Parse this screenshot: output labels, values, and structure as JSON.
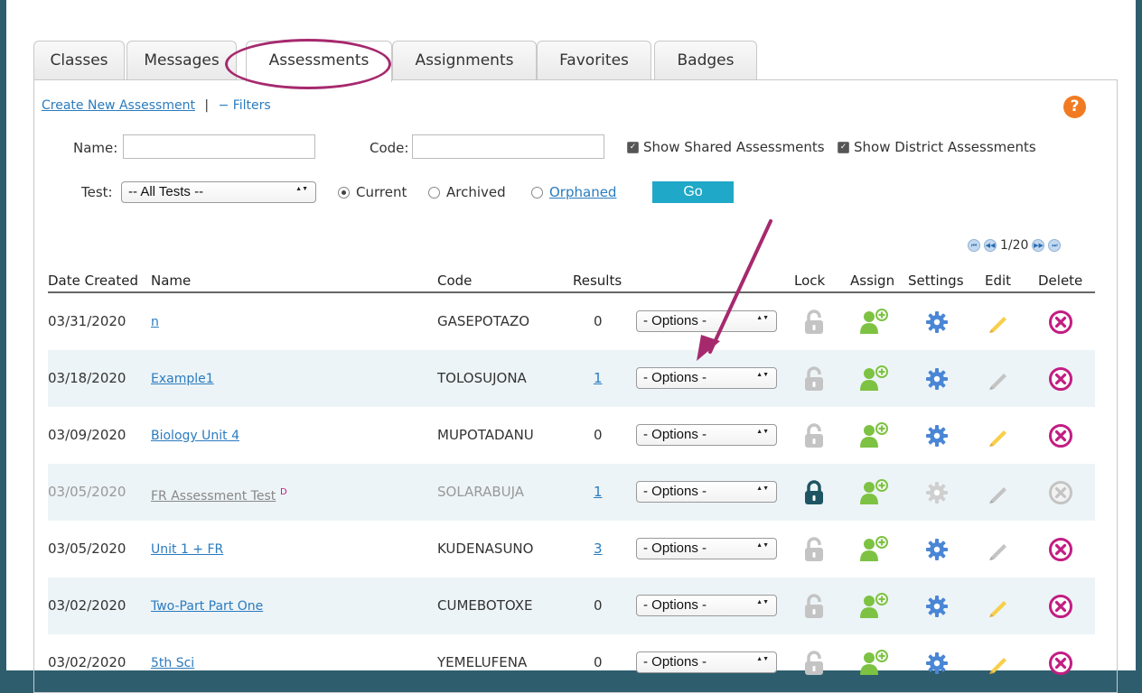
{
  "tabs": [
    "Classes",
    "Messages",
    "Assessments",
    "Assignments",
    "Favorites",
    "Badges"
  ],
  "active_tab": "Assessments",
  "links": {
    "create": "Create New Assessment",
    "separator": "|",
    "filters": "− Filters"
  },
  "help": "?",
  "filters": {
    "name_label": "Name:",
    "name_value": "",
    "code_label": "Code:",
    "code_value": "",
    "show_shared": "Show Shared Assessments",
    "show_district": "Show District Assessments",
    "test_label": "Test:",
    "test_value": "-- All Tests --",
    "radio_current": "Current",
    "radio_archived": "Archived",
    "radio_orphaned": "Orphaned",
    "selected_radio": "Current",
    "go": "Go"
  },
  "pager": {
    "text": "1/20"
  },
  "columns": [
    "Date Created",
    "Name",
    "Code",
    "Results",
    "Lock",
    "Assign",
    "Settings",
    "Edit",
    "Delete"
  ],
  "rows": [
    {
      "date": "03/31/2020",
      "name": "n",
      "code": "GASEPOTAZO",
      "results": "0",
      "options": "- Options -",
      "locked": false,
      "dim": false,
      "edit_active": true
    },
    {
      "date": "03/18/2020",
      "name": "Example1",
      "code": "TOLOSUJONA",
      "results": "1",
      "options": "- Options -",
      "locked": false,
      "dim": false,
      "edit_active": false
    },
    {
      "date": "03/09/2020",
      "name": "Biology Unit 4",
      "code": "MUPOTADANU",
      "results": "0",
      "options": "- Options -",
      "locked": false,
      "dim": false,
      "edit_active": true
    },
    {
      "date": "03/05/2020",
      "name": "FR Assessment Test",
      "badge": "D",
      "code": "SOLARABUJA",
      "results": "1",
      "options": "- Options -",
      "locked": true,
      "dim": true,
      "edit_active": false
    },
    {
      "date": "03/05/2020",
      "name": "Unit 1 + FR",
      "code": "KUDENASUNO",
      "results": "3",
      "options": "- Options -",
      "locked": false,
      "dim": false,
      "edit_active": false
    },
    {
      "date": "03/02/2020",
      "name": "Two-Part Part One",
      "code": "CUMEBOTOXE",
      "results": "0",
      "options": "- Options -",
      "locked": false,
      "dim": false,
      "edit_active": true
    },
    {
      "date": "03/02/2020",
      "name": "5th Sci",
      "code": "YEMELUFENA",
      "results": "0",
      "options": "- Options -",
      "locked": false,
      "dim": false,
      "edit_active": true
    }
  ],
  "colors": {
    "accent": "#2a7bbf",
    "annotation": "#a6296e",
    "go_button": "#1fa8c7",
    "assign_green": "#7dc242",
    "gear_blue": "#4a86d6",
    "pencil_yellow": "#f7cf4a",
    "delete_magenta": "#c21d82",
    "lock_teal": "#1f5562"
  }
}
